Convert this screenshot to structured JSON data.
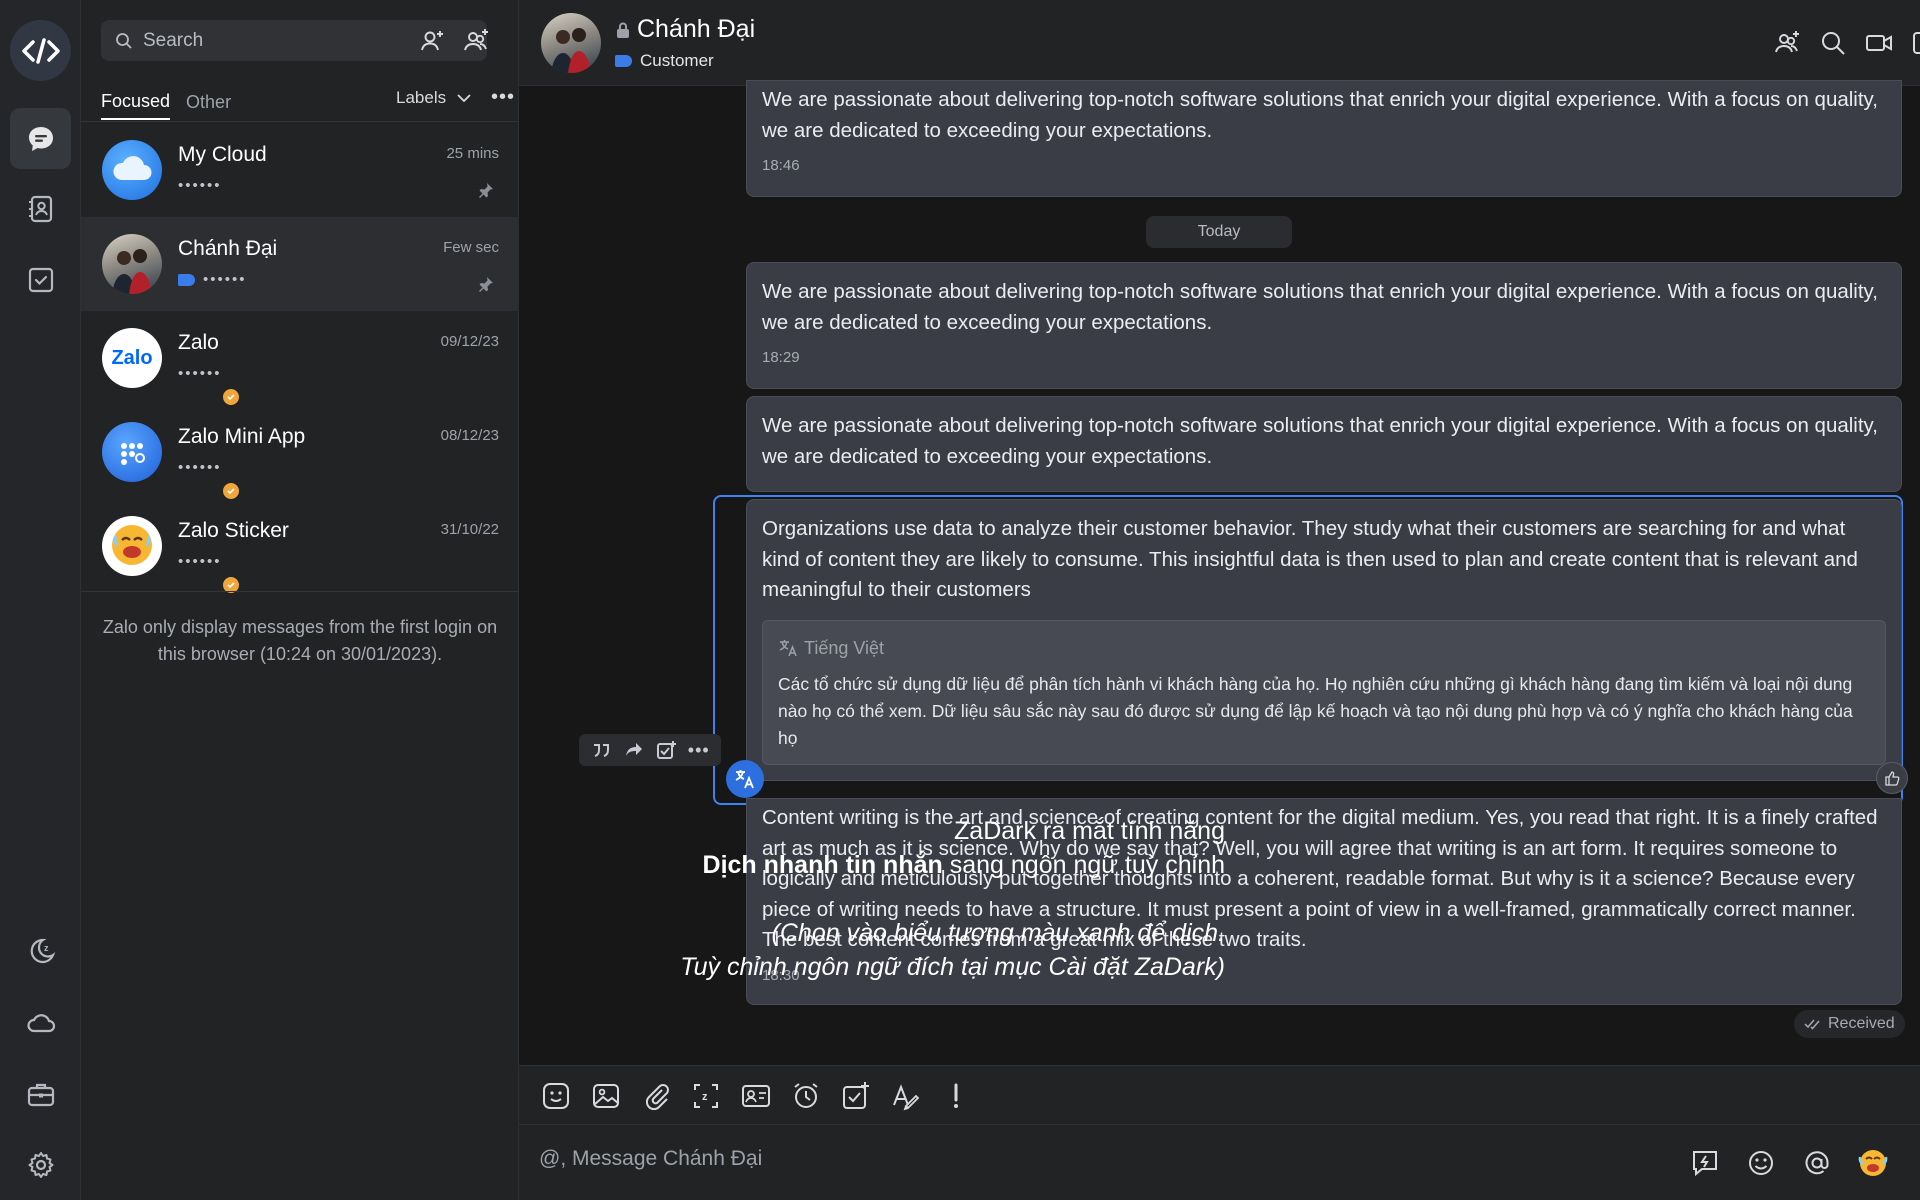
{
  "nav": {
    "items": [
      {
        "name": "messages",
        "icon": "chat-bubble-icon",
        "active": true
      },
      {
        "name": "contacts",
        "icon": "contact-book-icon"
      },
      {
        "name": "todo",
        "icon": "checkbox-icon"
      },
      {
        "name": "zadark",
        "icon": "moon-z-icon"
      },
      {
        "name": "cloud",
        "icon": "cloud-icon"
      },
      {
        "name": "toolbox",
        "icon": "briefcase-icon"
      },
      {
        "name": "settings",
        "icon": "gear-icon"
      }
    ]
  },
  "list": {
    "search_placeholder": "Search",
    "tabs": [
      {
        "label": "Focused"
      },
      {
        "label": "Other"
      }
    ],
    "labels_label": "Labels",
    "conversations": [
      {
        "name": "My Cloud",
        "time": "25 mins",
        "preview": "••••••",
        "pinned": true
      },
      {
        "name": "Chánh Đại",
        "time": "Few sec",
        "preview": "••••••",
        "pinned": true,
        "active": true
      },
      {
        "name": "Zalo",
        "time": "09/12/23",
        "preview": "••••••"
      },
      {
        "name": "Zalo Mini App",
        "time": "08/12/23",
        "preview": "••••••"
      },
      {
        "name": "Zalo Sticker",
        "time": "31/10/22",
        "preview": "••••••"
      }
    ],
    "notice": "Zalo only display messages from the first login on this browser (10:24 on 30/01/2023)."
  },
  "chat": {
    "title": "Chánh Đại",
    "label": "Customer",
    "date_separator": "Today",
    "messages": [
      {
        "text": "We are passionate about delivering top-notch software solutions that enrich your digital experience. With a focus on quality, we are dedicated to exceeding your expectations.",
        "time": "18:46"
      },
      {
        "text": "We are passionate about delivering top-notch software solutions that enrich your digital experience. With a focus on quality, we are dedicated to exceeding your expectations.",
        "time": "18:29"
      },
      {
        "text": "We are passionate about delivering top-notch software solutions that enrich your digital experience. With a focus on quality, we are dedicated to exceeding your expectations."
      },
      {
        "text": "Organizations use data to analyze their customer behavior. They study what their customers are searching for and what kind of content they are likely to consume. This insightful data is then used to plan and create content that is relevant and meaningful to their customers",
        "translation_lang": "Tiếng Việt",
        "translation": "Các tổ chức sử dụng dữ liệu để phân tích hành vi khách hàng của họ. Họ nghiên cứu những gì khách hàng đang tìm kiếm và loại nội dung nào họ có thể xem. Dữ liệu sâu sắc này sau đó được sử dụng để lập kế hoạch và tạo nội dung phù hợp và có ý nghĩa cho khách hàng của họ"
      },
      {
        "text": "Content writing is the art and science of creating content for the digital medium. Yes, you read that right. It is a finely crafted art as much as it is science. Why do we say that? Well, you will agree that writing is an art form. It requires someone to logically and meticulously put together thoughts into a coherent, readable format. But why is it a science? Because every piece of writing needs to have a structure. It must present a point of view in a well-framed, grammatically correct manner. The best content comes from a great mix of these two traits.",
        "time": "18:30"
      }
    ],
    "status": "Received",
    "composer_placeholder": "@, Message Chánh Đại"
  },
  "promo": {
    "line1": "ZaDark ra mắt tính năng",
    "line2_bold": "Dịch nhanh tin nhắn",
    "line2_rest": " sang ngôn ngữ tuỳ chỉnh",
    "line3": "(Chọn vào biểu tượng màu xanh để dịch.",
    "line4": "Tuỳ chỉnh ngôn ngữ đích tại mục Cài đặt ZaDark)"
  },
  "colors": {
    "accent": "#3f82f3",
    "translate_button": "#2e6fe0",
    "verified_badge": "#f0a63a",
    "label_tag": "#3b7de8"
  }
}
